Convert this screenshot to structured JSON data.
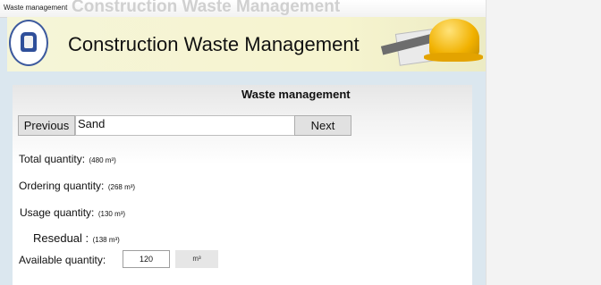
{
  "window": {
    "title": "Waste management",
    "ghost_title": "Construction Waste Management"
  },
  "header": {
    "title": "Construction Waste Management",
    "logo_icon": "university-seal-icon",
    "banner_icon": "helmet-blueprint-icon"
  },
  "panel": {
    "title": "Waste management",
    "previous_label": "Previous",
    "next_label": "Next",
    "material_value": "Sand"
  },
  "quantities": {
    "total_label": "Total quantity:",
    "total_value": "(480 m³)",
    "ordering_label": "Ordering quantity:",
    "ordering_value": "(268 m³)",
    "usage_label": "Usage quantity:",
    "usage_value": "(130 m³)",
    "residual_label": "Resedual :",
    "residual_value": "(138 m³)",
    "available_label": "Available quantity:",
    "available_value": "120",
    "available_unit": "m³"
  }
}
